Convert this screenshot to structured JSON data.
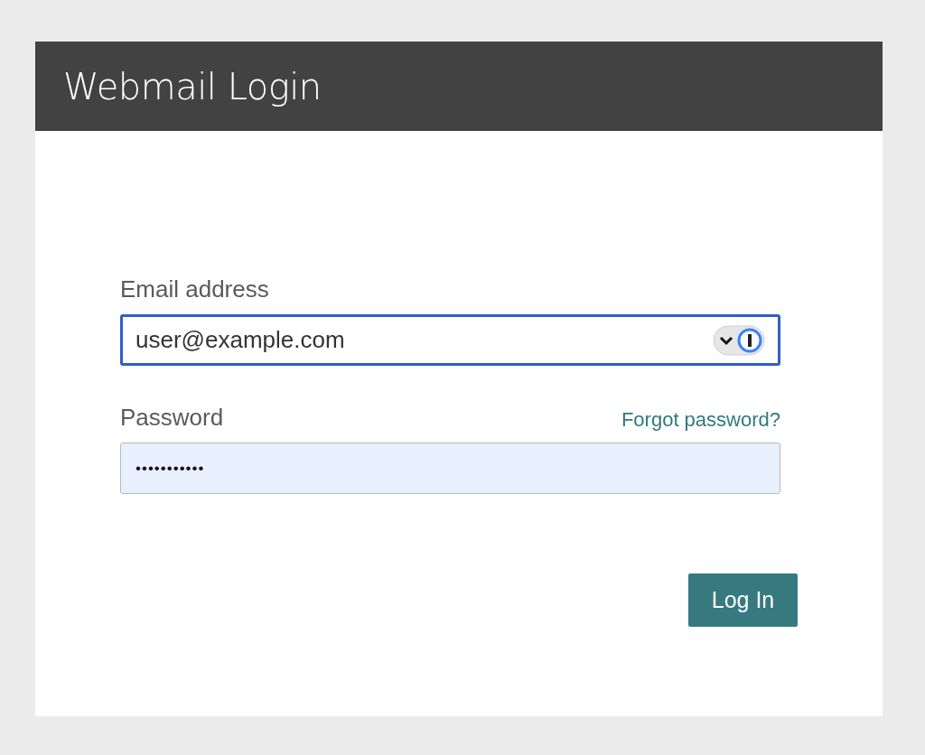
{
  "header": {
    "title": "Webmail Login"
  },
  "email": {
    "label": "Email address",
    "value": "user@example.com",
    "focused": true
  },
  "password": {
    "label": "Password",
    "link": "Forgot password?",
    "value": "•••••••••••",
    "autofilled": true
  },
  "buttons": [
    {
      "label": "Log In"
    }
  ]
}
